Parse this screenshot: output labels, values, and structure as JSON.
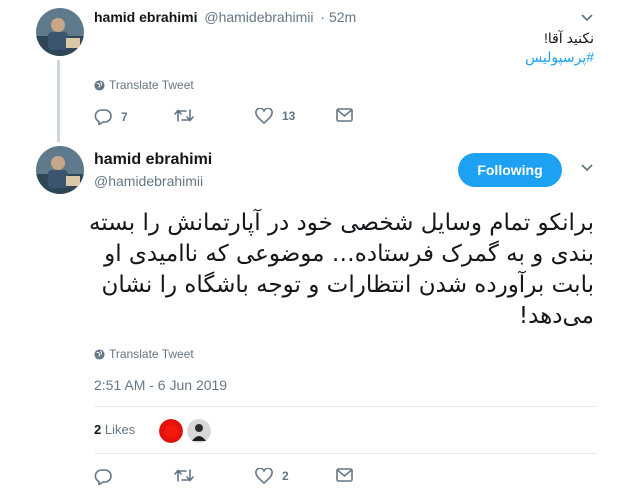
{
  "tweet1": {
    "name": "hamid ebrahimi",
    "handle": "@hamidebrahimii",
    "time": "52m",
    "text": "نکنید آقا!",
    "hashtag": "#پرسپولیس",
    "translate_label": "Translate Tweet",
    "replies": "7",
    "retweets": "",
    "likes": "13"
  },
  "tweet2": {
    "name": "hamid ebrahimi",
    "handle": "@hamidebrahimii",
    "follow_label": "Following",
    "text": "برانکو تمام وسایل شخصی خود در آپارتمانش را بسته بندی و به گمرک فرستاده… موضوعی که ناامیدی او بابت برآورده شدن انتظارات و توجه باشگاه را نشان می‌دهد!",
    "translate_label": "Translate Tweet",
    "timestamp": "2:51 AM - 6 Jun 2019",
    "likes_count": "2",
    "likes_label": "Likes",
    "replies": "",
    "retweets": "",
    "likes": "2"
  },
  "colors": {
    "accent": "#1da1f2",
    "secondary_text": "#657786",
    "primary_text": "#14171a",
    "divider": "#e6ecf0"
  },
  "icons": [
    "reply-icon",
    "retweet-icon",
    "heart-icon",
    "dm-icon",
    "globe-icon",
    "chevron-down-icon"
  ]
}
